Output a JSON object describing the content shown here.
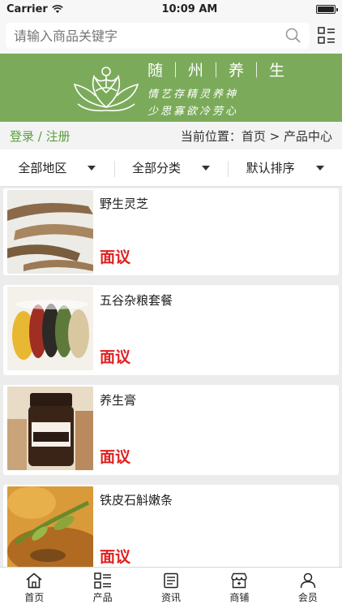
{
  "status_bar": {
    "carrier": "Carrier",
    "time": "10:09 AM"
  },
  "search": {
    "placeholder": "请输入商品关键字"
  },
  "banner": {
    "title": "随｜州｜养｜生",
    "subtitle_1": "情艺存精灵养神",
    "subtitle_2": "少思寡欲冷劳心"
  },
  "crumbs": {
    "login": "登录 / 注册",
    "location": "当前位置：首页 > 产品中心"
  },
  "filters": [
    {
      "label": "全部地区"
    },
    {
      "label": "全部分类"
    },
    {
      "label": "默认排序"
    }
  ],
  "products": [
    {
      "title": "野生灵芝",
      "price": "面议"
    },
    {
      "title": "五谷杂粮套餐",
      "price": "面议"
    },
    {
      "title": "养生膏",
      "price": "面议"
    },
    {
      "title": "铁皮石斛嫩条",
      "price": "面议"
    }
  ],
  "tabs": [
    {
      "label": "首页",
      "icon": "home-icon"
    },
    {
      "label": "产品",
      "icon": "grid-list-icon"
    },
    {
      "label": "资讯",
      "icon": "news-icon"
    },
    {
      "label": "商铺",
      "icon": "store-icon"
    },
    {
      "label": "会员",
      "icon": "user-icon"
    }
  ],
  "colors": {
    "accent_green": "#7bab5a",
    "login_green": "#5a9f3c",
    "price_red": "#e02020"
  }
}
